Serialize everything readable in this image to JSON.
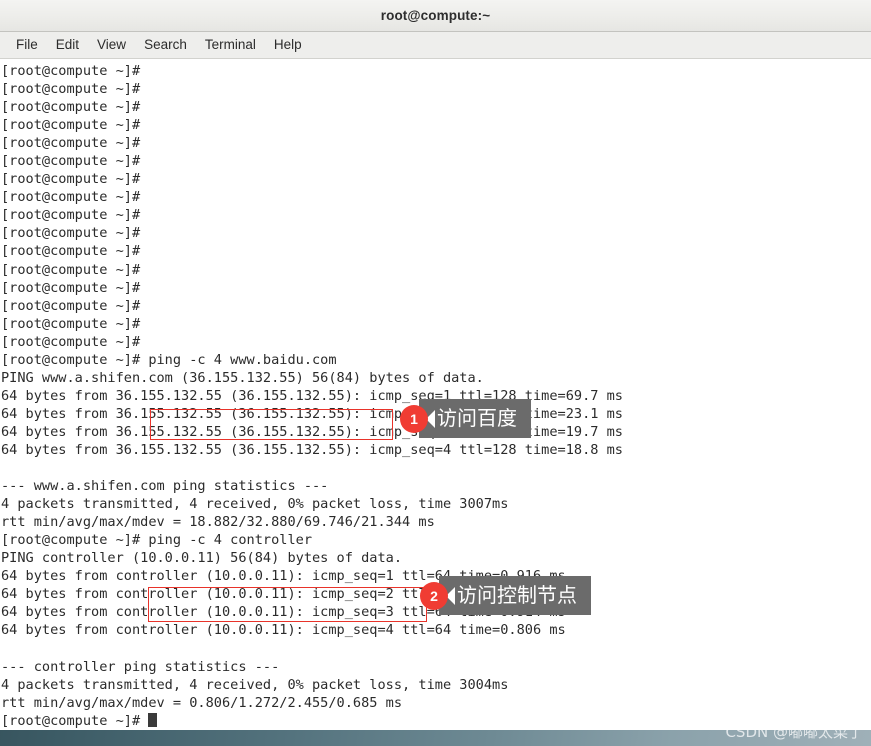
{
  "window": {
    "title": "root@compute:~"
  },
  "menu": {
    "items": [
      {
        "label": "File"
      },
      {
        "label": "Edit"
      },
      {
        "label": "View"
      },
      {
        "label": "Search"
      },
      {
        "label": "Terminal"
      },
      {
        "label": "Help"
      }
    ]
  },
  "terminal": {
    "prompt": "[root@compute ~]# ",
    "lines": [
      "[root@compute ~]#",
      "[root@compute ~]#",
      "[root@compute ~]#",
      "[root@compute ~]#",
      "[root@compute ~]#",
      "[root@compute ~]#",
      "[root@compute ~]#",
      "[root@compute ~]#",
      "[root@compute ~]#",
      "[root@compute ~]#",
      "[root@compute ~]#",
      "[root@compute ~]#",
      "[root@compute ~]#",
      "[root@compute ~]#",
      "[root@compute ~]#",
      "[root@compute ~]#",
      "[root@compute ~]# ping -c 4 www.baidu.com",
      "PING www.a.shifen.com (36.155.132.55) 56(84) bytes of data.",
      "64 bytes from 36.155.132.55 (36.155.132.55): icmp_seq=1 ttl=128 time=69.7 ms",
      "64 bytes from 36.155.132.55 (36.155.132.55): icmp_seq=2 ttl=128 time=23.1 ms",
      "64 bytes from 36.155.132.55 (36.155.132.55): icmp_seq=3 ttl=128 time=19.7 ms",
      "64 bytes from 36.155.132.55 (36.155.132.55): icmp_seq=4 ttl=128 time=18.8 ms",
      "",
      "--- www.a.shifen.com ping statistics ---",
      "4 packets transmitted, 4 received, 0% packet loss, time 3007ms",
      "rtt min/avg/max/mdev = 18.882/32.880/69.746/21.344 ms",
      "[root@compute ~]# ping -c 4 controller",
      "PING controller (10.0.0.11) 56(84) bytes of data.",
      "64 bytes from controller (10.0.0.11): icmp_seq=1 ttl=64 time=0.916 ms",
      "64 bytes from controller (10.0.0.11): icmp_seq=2 ttl=64 time=2.45 ms",
      "64 bytes from controller (10.0.0.11): icmp_seq=3 ttl=64 time=0.914 ms",
      "64 bytes from controller (10.0.0.11): icmp_seq=4 ttl=64 time=0.806 ms",
      "",
      "--- controller ping statistics ---",
      "4 packets transmitted, 4 received, 0% packet loss, time 3004ms",
      "rtt min/avg/max/mdev = 0.806/1.272/2.455/0.685 ms"
    ],
    "last_prompt": "[root@compute ~]# "
  },
  "annotations": [
    {
      "number": "1",
      "text": "访问百度"
    },
    {
      "number": "2",
      "text": "访问控制节点"
    }
  ],
  "watermark": {
    "text": "CSDN @嘟嘟太菜了"
  },
  "colors": {
    "annotation_badge": "#f03c33",
    "annotation_bubble": "#6b6b6b",
    "highlight_box": "#e8332a",
    "terminal_bg": "#ffffff",
    "terminal_fg": "#2b2b2b"
  }
}
